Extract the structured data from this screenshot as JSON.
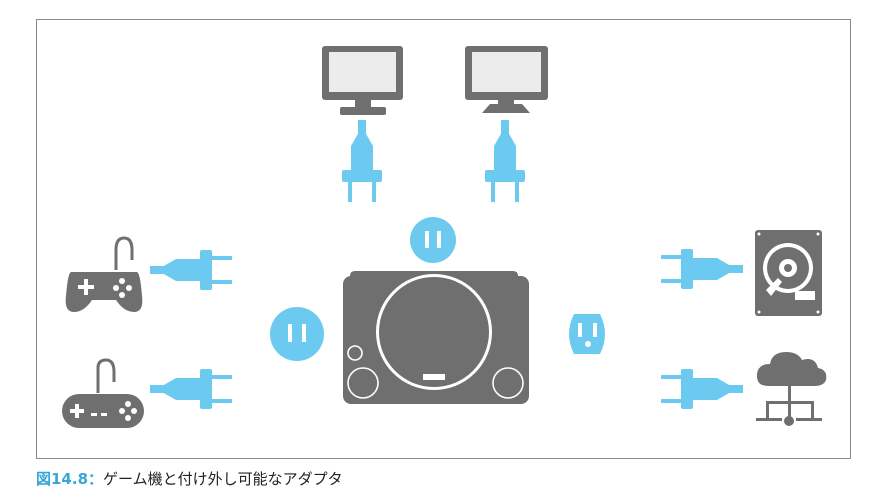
{
  "figure": {
    "label": "図14.8：",
    "caption": "ゲーム機と付け外し可能なアダプタ"
  },
  "colors": {
    "gray": "#6f6f6f",
    "blue": "#6ccaf1",
    "screen": "#ececec",
    "label": "#3aa5d8",
    "frame": "#8a8a8a"
  },
  "items": {
    "console": "game-console-icon",
    "devices": [
      "monitor-icon",
      "monitor-icon",
      "gamepad-icon",
      "gamepad-icon",
      "hard-disk-icon",
      "network-icon"
    ],
    "outlets": [
      "socket-round-icon",
      "socket-round-icon",
      "socket-grounded-icon"
    ]
  }
}
